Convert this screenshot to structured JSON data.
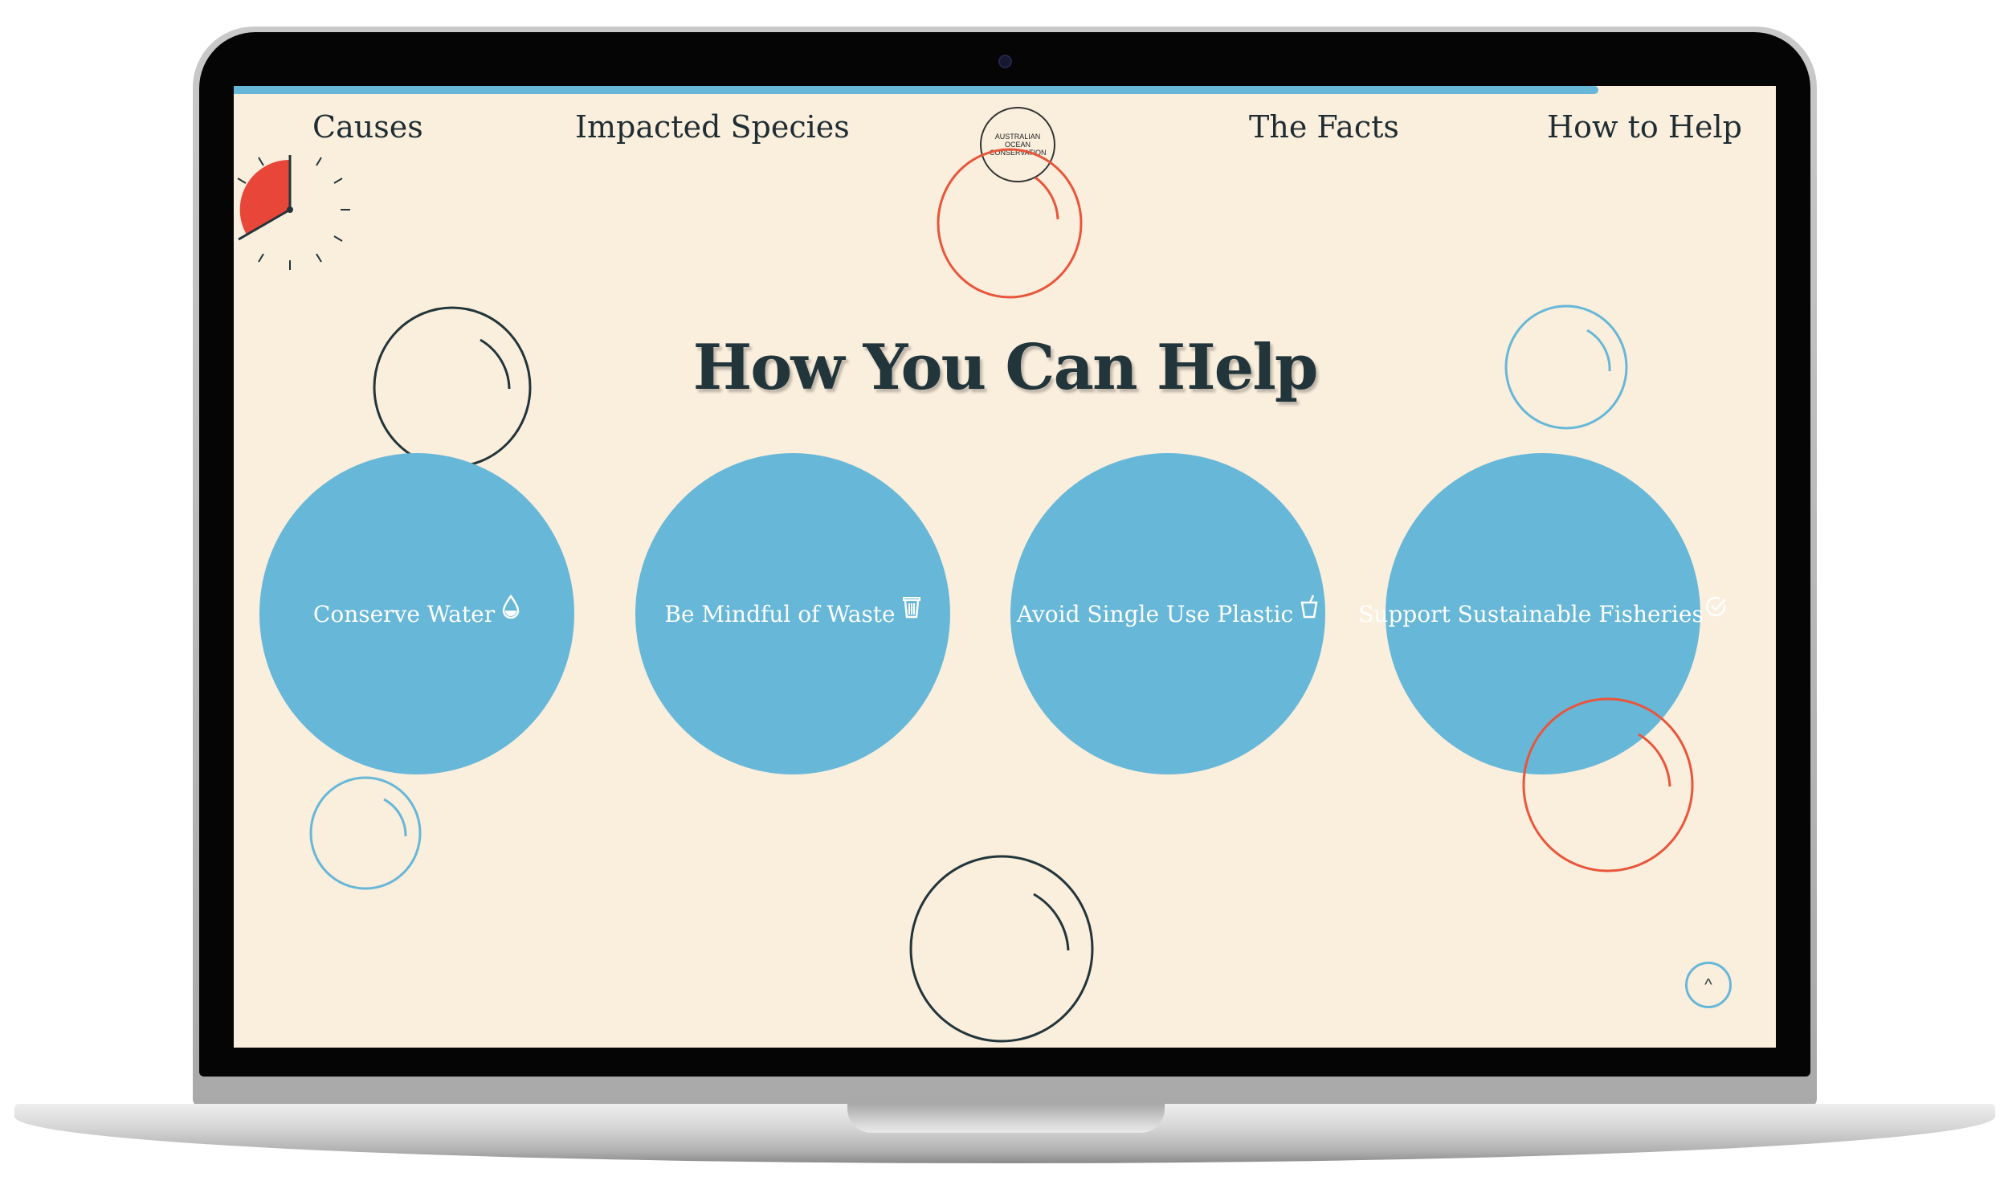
{
  "nav": {
    "items": [
      {
        "label": "Causes"
      },
      {
        "label": "Impacted Species"
      },
      {
        "label": "The Facts"
      },
      {
        "label": "How to Help"
      }
    ],
    "logo_text": "AUSTRALIAN OCEAN CONSERVATION"
  },
  "progress": {
    "fraction": 0.885
  },
  "page_title": "How You Can Help",
  "actions": [
    {
      "label": "Conserve Water",
      "icon": "water-drop-icon"
    },
    {
      "label": "Be Mindful of Waste",
      "icon": "trash-icon"
    },
    {
      "label": "Avoid Single Use Plastic",
      "icon": "cup-icon"
    },
    {
      "label": "Support Sustainable Fisheries",
      "icon": "check-circle-icon"
    }
  ],
  "scroll_top_label": "^",
  "colors": {
    "background": "#faeedd",
    "accent_blue": "#67b7d8",
    "accent_red": "#e9553a",
    "text_dark": "#22353b"
  }
}
